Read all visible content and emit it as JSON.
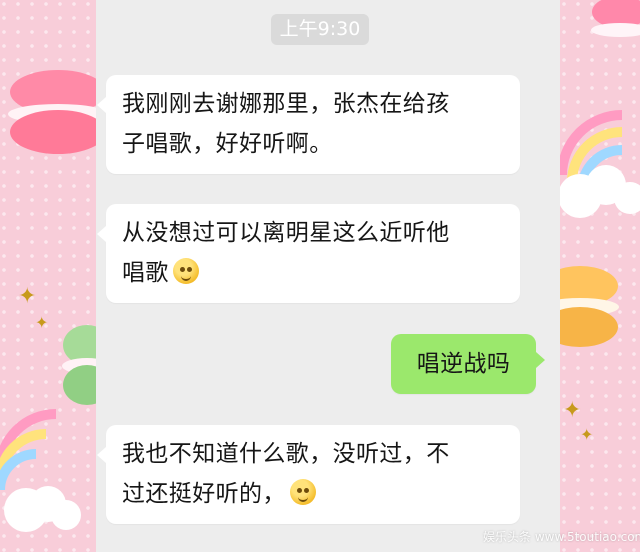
{
  "chat": {
    "timestamp": "上午9:30",
    "messages": [
      {
        "side": "left",
        "lines": [
          "我刚刚去谢娜那里，张杰在给孩",
          "子唱歌，好好听啊。"
        ]
      },
      {
        "side": "left",
        "lines": [
          "从没想过可以离明星这么近听他",
          "唱歌"
        ],
        "emoji": "thinking-face-icon"
      },
      {
        "side": "right",
        "text": "唱逆战吗"
      },
      {
        "side": "left",
        "lines": [
          "我也不知道什么歌，没听过，不",
          "过还挺好听的，"
        ],
        "emoji": "laughing-crying-face-icon"
      }
    ]
  },
  "watermark": {
    "text": "娱乐头条 www.5toutiao.com"
  },
  "theme": {
    "chat_background": "#ededed",
    "incoming_bubble": "#ffffff",
    "outgoing_bubble": "#9be86c",
    "wallpaper": "#f8cdd9"
  }
}
